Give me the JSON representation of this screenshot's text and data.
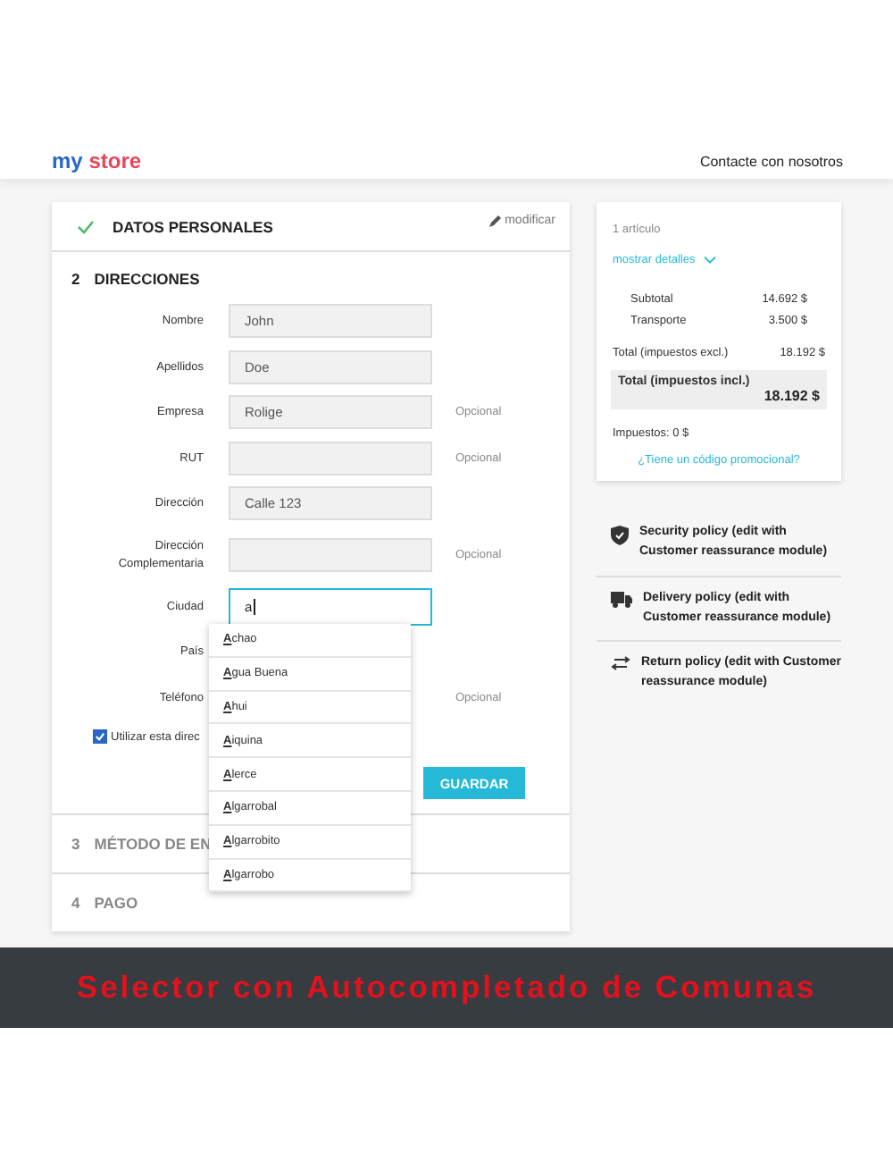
{
  "header": {
    "logo_left": "my",
    "logo_right": "store",
    "contact_link": "Contacte con nosotros"
  },
  "steps": {
    "personal": {
      "title": "DATOS PERSONALES",
      "done": true,
      "edit_link": "modificar"
    },
    "address": {
      "number": "2",
      "title": "DIRECCIONES",
      "fields": [
        {
          "label": "Nombre",
          "value": "John"
        },
        {
          "label": "Apellidos",
          "value": "Doe"
        },
        {
          "label": "Empresa",
          "value": "Rolige",
          "note": "Opcional"
        },
        {
          "label": "RUT",
          "note": "Opcional"
        },
        {
          "label": "Dirección",
          "value": "Calle 123"
        },
        {
          "label": "Dirección Complementaria",
          "note": "Opcional"
        },
        {
          "label": "Ciudad",
          "value": "a",
          "focused": true
        },
        {
          "label": "País"
        },
        {
          "label": "Teléfono",
          "note": "Opcional"
        }
      ],
      "checkbox": {
        "label": "Utilizar esta direc",
        "checked": true
      },
      "save_button": "GUARDAR",
      "suggestions": [
        "**A**chao",
        "**A**gua Buena",
        "**A**hui",
        "**A**iquina",
        "**A**lerce",
        "**A**lgarrobal",
        "**A**lgarrobito",
        "**A**lgarrobo"
      ]
    },
    "shipping": {
      "number": "3",
      "title": "MÉTODO DE EN"
    },
    "payment": {
      "number": "4",
      "title": "PAGO"
    }
  },
  "summary": {
    "items_count": "1 artículo",
    "details_link": "mostrar detalles",
    "lines": [
      {
        "label": "Subtotal",
        "value": "14.692 $"
      },
      {
        "label": "Transporte",
        "value": "3.500 $"
      }
    ],
    "total_excl": {
      "label": "Total (impuestos excl.)",
      "value": "18.192 $"
    },
    "total_incl": {
      "label": "Total (impuestos incl.)",
      "value": "18.192 $"
    },
    "taxes": "Impuestos: 0 $",
    "promo_link": "¿Tiene un código promocional?"
  },
  "reassurance": [
    {
      "kind": "shield",
      "text": "Security policy (edit with Customer reassurance module)"
    },
    {
      "kind": "truck",
      "text": "Delivery policy (edit with Customer reassurance module)"
    },
    {
      "kind": "arrows",
      "text": "Return policy (edit with Customer reassurance module)"
    }
  ],
  "banner": "Selector con Autocompletado de Comunas"
}
